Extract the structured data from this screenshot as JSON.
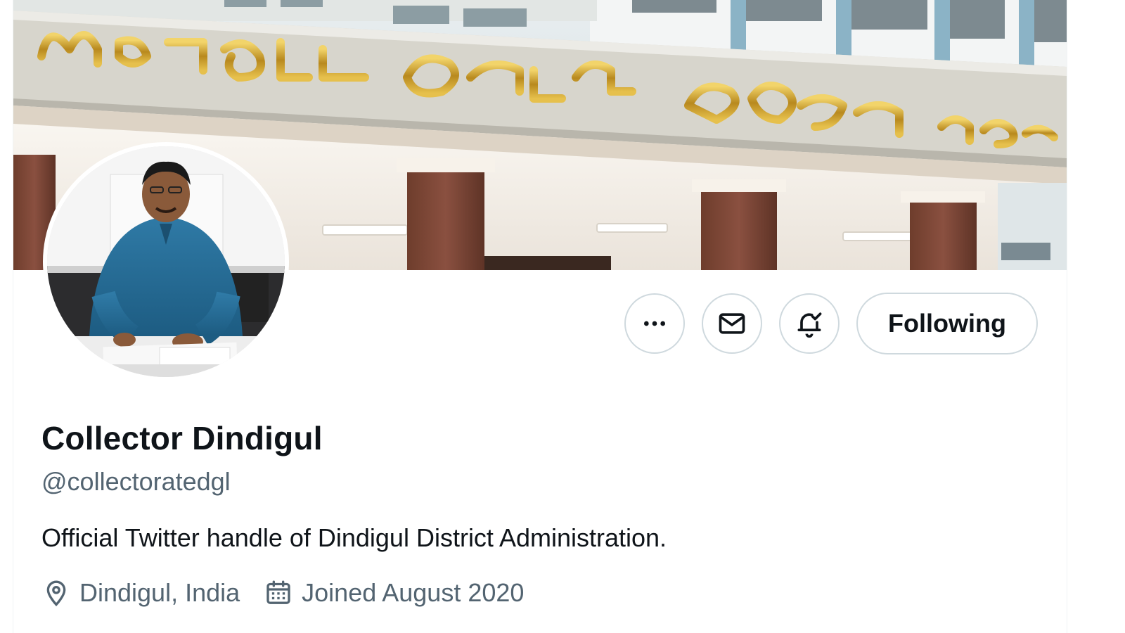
{
  "profile": {
    "display_name": "Collector Dindigul",
    "handle": "@collectoratedgl",
    "bio": "Official Twitter handle of Dindigul District Administration.",
    "location": "Dindigul, India",
    "joined": "Joined August 2020"
  },
  "banner": {
    "sign_line_1": "மாவட்ட ஆட்சியர் அலுவலகம் திண்டுக்கல்"
  },
  "actions": {
    "more_icon": "more-horizontal-icon",
    "message_icon": "mail-icon",
    "notify_icon": "bell-check-icon",
    "following_label": "Following"
  },
  "colors": {
    "primary_text": "#0f1419",
    "secondary_text": "#536471",
    "border": "#cfd9de"
  }
}
